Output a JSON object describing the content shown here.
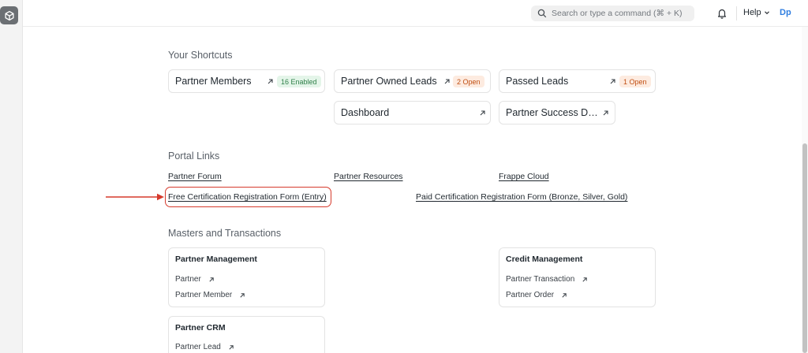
{
  "navbar": {
    "search_placeholder": "Search or type a command (⌘ + K)",
    "help_label": "Help",
    "avatar_initials": "Dp"
  },
  "shortcuts": {
    "title": "Your Shortcuts",
    "items": [
      {
        "label": "Partner Members",
        "badge": "16 Enabled",
        "badge_color": "#30804a"
      },
      {
        "label": "Partner Owned Leads",
        "badge": "2 Open",
        "badge_color": "#c04e12"
      },
      {
        "label": "Passed Leads",
        "badge": "1 Open",
        "badge_color": "#c04e12"
      },
      {
        "label": "Dashboard"
      },
      {
        "label": "Partner Success Da..."
      }
    ]
  },
  "portal_links": {
    "title": "Portal Links",
    "links": [
      "Partner Forum",
      "Partner Resources",
      "Frappe Cloud",
      "Free Certification Registration Form (Entry)",
      "Paid Certification Registration Form (Bronze, Silver, Gold)"
    ]
  },
  "masters": {
    "title": "Masters and Transactions",
    "cards": [
      {
        "title": "Partner Management",
        "items": [
          "Partner",
          "Partner Member"
        ]
      },
      {
        "title": "Credit Management",
        "items": [
          "Partner Transaction",
          "Partner Order"
        ]
      },
      {
        "title": "Partner CRM",
        "items": [
          "Partner Lead"
        ]
      }
    ]
  },
  "colors": {
    "annotation": "#d63a2c",
    "accent": "#2f7ee0"
  }
}
